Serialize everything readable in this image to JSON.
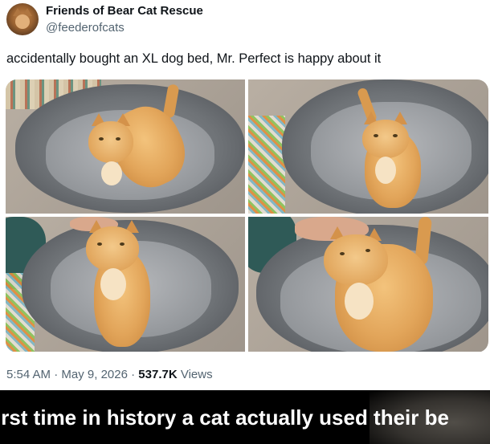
{
  "tweet": {
    "author": {
      "display_name": "Friends of Bear Cat Rescue",
      "handle": "@feederofcats",
      "avatar": "cat-avatar"
    },
    "text": "accidentally bought an XL dog bed, Mr. Perfect is happy about it",
    "media": [
      {
        "label": "cat-standing-in-dog-bed"
      },
      {
        "label": "cat-sitting-in-dog-bed"
      },
      {
        "label": "cat-being-petted-front"
      },
      {
        "label": "cat-being-petted-closeup"
      }
    ],
    "meta": {
      "time": "5:54 AM",
      "separator": "·",
      "date": "May 9, 2026",
      "views_count": "537.7K",
      "views_label": "Views"
    }
  },
  "caption": {
    "text": "irst time in history a cat actually used their be"
  },
  "colors": {
    "text_primary": "#0f1419",
    "text_secondary": "#536471",
    "caption_bg": "#000000",
    "caption_text": "#ffffff"
  }
}
